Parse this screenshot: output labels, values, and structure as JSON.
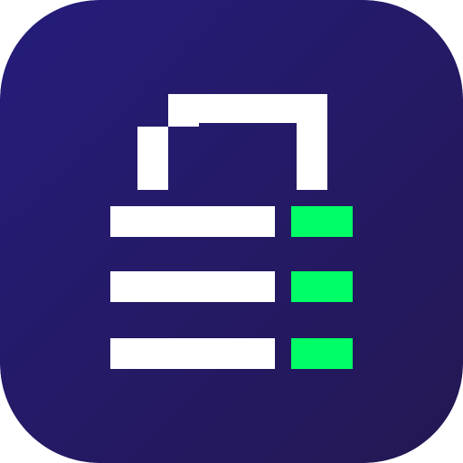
{
  "icon": {
    "name": "lock-list-app-icon",
    "colors": {
      "background_start": "#241D7A",
      "background_end": "#241753",
      "bars": "#FFFFFF",
      "indicators": "#00FF66"
    }
  }
}
